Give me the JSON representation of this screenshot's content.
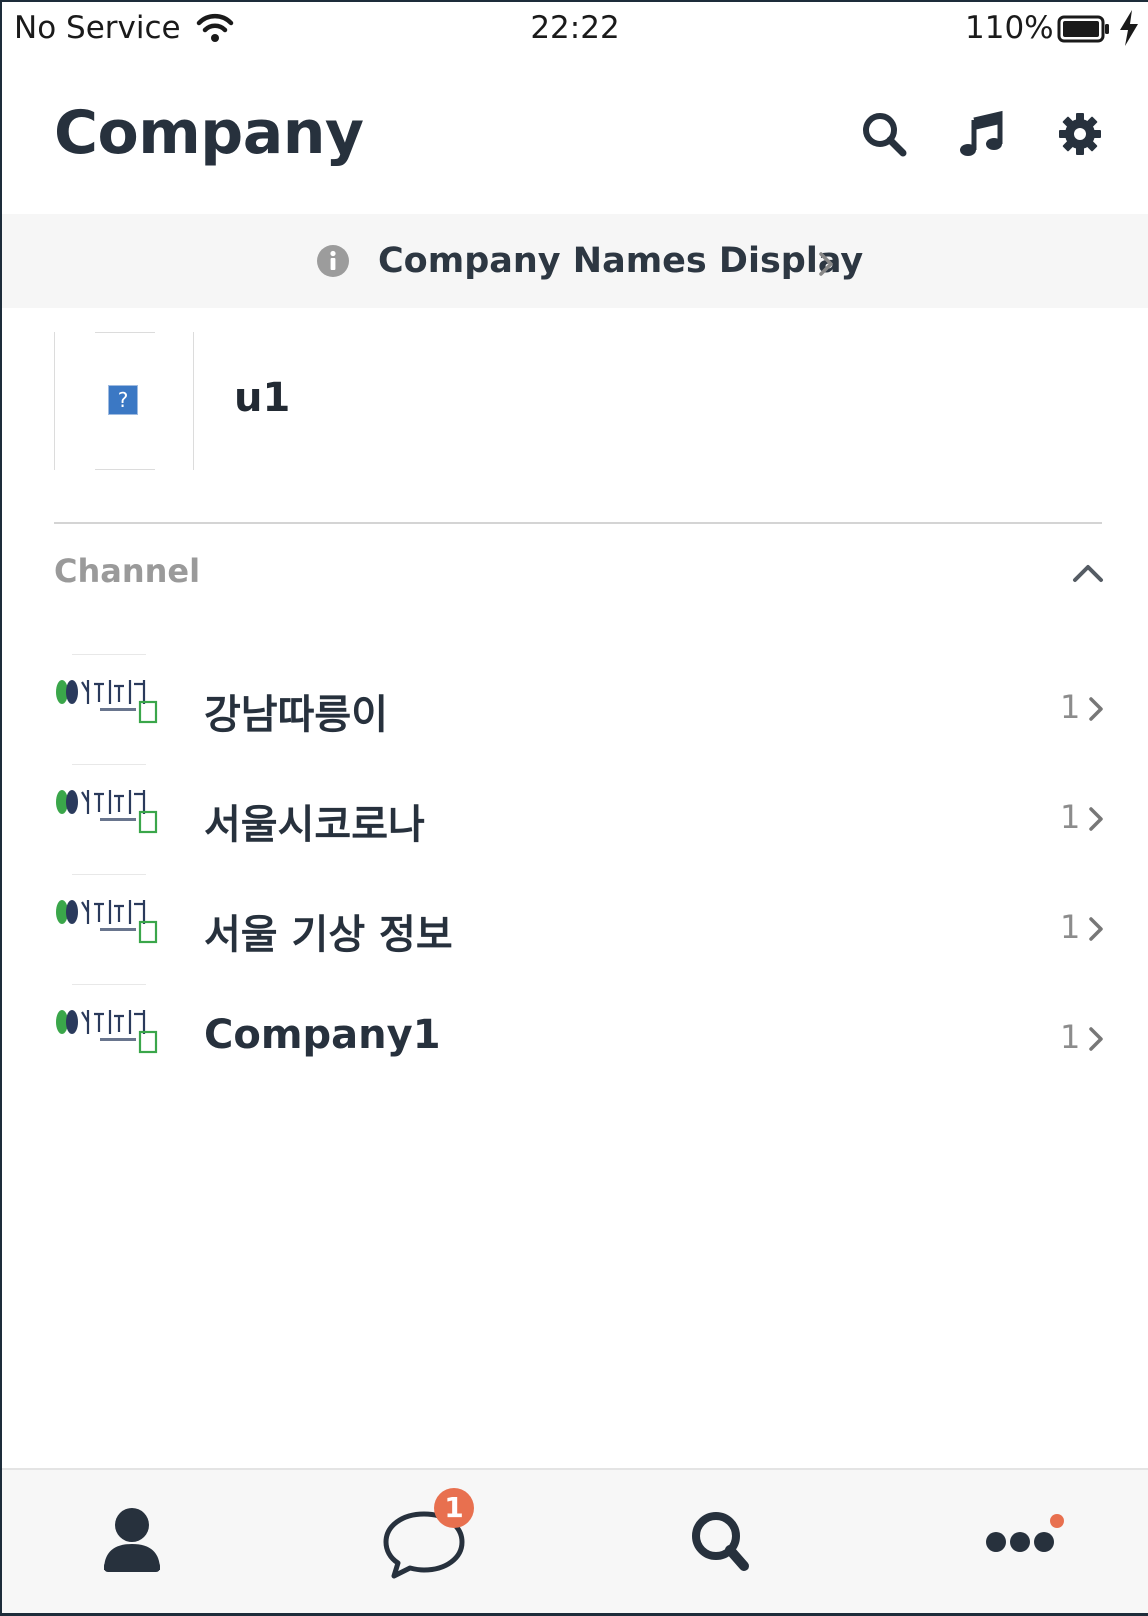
{
  "status_bar": {
    "carrier": "No Service",
    "time": "22:22",
    "battery": "110%"
  },
  "header": {
    "title": "Company",
    "icons": [
      "search-icon",
      "music-note-icon",
      "gear-icon"
    ]
  },
  "notice": {
    "text": "Company Names Display"
  },
  "profile": {
    "name": "u1",
    "avatar_placeholder": "?"
  },
  "channel_section": {
    "title": "Channel",
    "expanded": true,
    "items": [
      {
        "name": "강남따릉이",
        "count": "1",
        "logo": "seoul-bike-logo"
      },
      {
        "name": "서울시코로나",
        "count": "1",
        "logo": "seoul-bike-logo"
      },
      {
        "name": "서울 기상 정보",
        "count": "1",
        "logo": "seoul-bike-logo"
      },
      {
        "name": "Company1",
        "count": "1",
        "logo": "seoul-bike-logo"
      }
    ]
  },
  "tab_bar": {
    "tabs": [
      "person-icon",
      "chat-bubble-icon",
      "search-icon",
      "more-icon"
    ],
    "chat_badge": "1",
    "accent": "#e8704f"
  },
  "colors": {
    "text_primary": "#27313d",
    "muted": "#9a9a9a",
    "logo_green": "#3aa64a",
    "logo_navy": "#2a3a5c"
  }
}
